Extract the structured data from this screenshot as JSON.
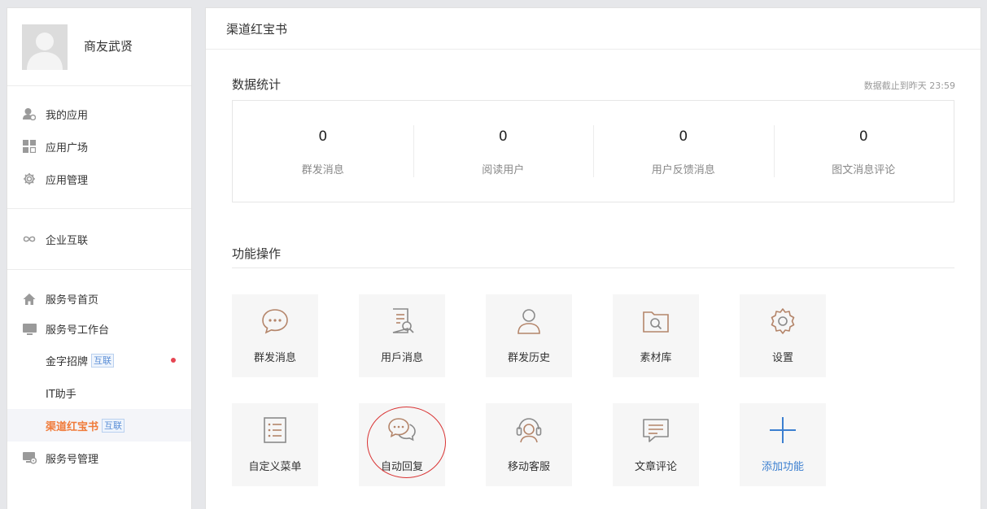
{
  "profile": {
    "name": "商友武贤"
  },
  "sidebar": {
    "group1": [
      {
        "label": "我的应用",
        "icon": "user-app-icon"
      },
      {
        "label": "应用广场",
        "icon": "grid-icon"
      },
      {
        "label": "应用管理",
        "icon": "gear-icon"
      }
    ],
    "group2": [
      {
        "label": "企业互联",
        "icon": "infinity-icon"
      }
    ],
    "group3": {
      "home": {
        "label": "服务号首页",
        "icon": "home-icon"
      },
      "workbench": {
        "label": "服务号工作台",
        "icon": "monitor-icon"
      },
      "subitems": [
        {
          "label": "金字招牌",
          "tag": "互联",
          "dot": true
        },
        {
          "label": "IT助手"
        },
        {
          "label": "渠道红宝书",
          "tag": "互联",
          "active": true
        }
      ],
      "manage": {
        "label": "服务号管理",
        "icon": "monitor-gear-icon"
      }
    }
  },
  "main": {
    "header": "渠道红宝书",
    "stats": {
      "title": "数据统计",
      "note": "数据截止到昨天 23:59",
      "items": [
        {
          "value": "0",
          "label": "群发消息"
        },
        {
          "value": "0",
          "label": "阅读用户"
        },
        {
          "value": "0",
          "label": "用户反馈消息"
        },
        {
          "value": "0",
          "label": "图文消息评论"
        }
      ]
    },
    "functions": {
      "title": "功能操作",
      "tiles": [
        {
          "label": "群发消息",
          "icon": "chat-bubble-icon"
        },
        {
          "label": "用戶消息",
          "icon": "document-search-icon"
        },
        {
          "label": "群发历史",
          "icon": "person-icon"
        },
        {
          "label": "素材库",
          "icon": "folder-search-icon"
        },
        {
          "label": "设置",
          "icon": "settings-gear-icon"
        },
        {
          "label": "自定义菜单",
          "icon": "list-icon"
        },
        {
          "label": "自动回复",
          "icon": "chat-bubbles-icon"
        },
        {
          "label": "移动客服",
          "icon": "headset-icon"
        },
        {
          "label": "文章评论",
          "icon": "comment-icon"
        },
        {
          "label": "添加功能",
          "icon": "plus-icon"
        }
      ]
    }
  },
  "colors": {
    "accent": "#f07b3a",
    "icon_stroke": "#b4856a",
    "link": "#3b7fd0",
    "annotation": "#d93434"
  }
}
